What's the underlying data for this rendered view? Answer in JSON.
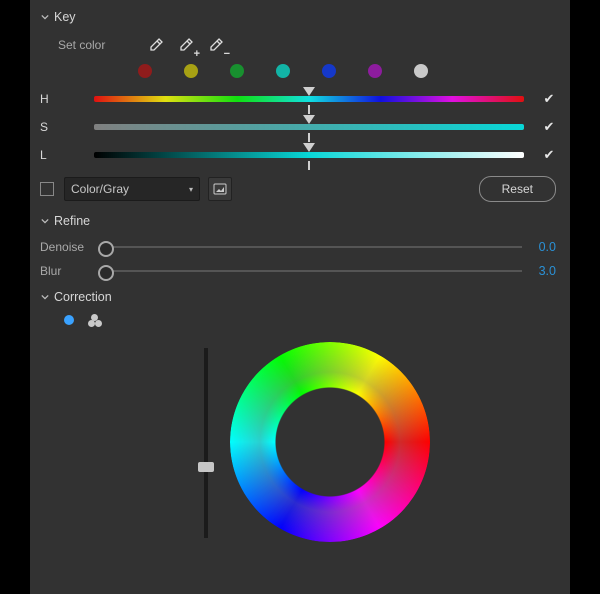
{
  "sections": {
    "key": {
      "title": "Key",
      "set_color_label": "Set color"
    },
    "refine": {
      "title": "Refine"
    },
    "correction": {
      "title": "Correction"
    }
  },
  "swatches": [
    {
      "name": "red",
      "color": "#8f1c1c"
    },
    {
      "name": "yellow",
      "color": "#a7a114"
    },
    {
      "name": "green",
      "color": "#18902f"
    },
    {
      "name": "cyan",
      "color": "#12b4a6"
    },
    {
      "name": "blue",
      "color": "#1538c9"
    },
    {
      "name": "magenta",
      "color": "#8d1c9e"
    },
    {
      "name": "white",
      "color": "#c9c9c9"
    }
  ],
  "hsl": {
    "h": {
      "label": "H",
      "pos_pct": 50,
      "checked": true
    },
    "s": {
      "label": "S",
      "pos_pct": 50,
      "checked": true
    },
    "l": {
      "label": "L",
      "pos_pct": 50,
      "checked": true
    }
  },
  "dropdown": {
    "value": "Color/Gray",
    "checkbox_checked": false
  },
  "reset_label": "Reset",
  "refine": {
    "denoise": {
      "label": "Denoise",
      "value": "0.0",
      "pos_pct": 0
    },
    "blur": {
      "label": "Blur",
      "value": "3.0",
      "pos_pct": 0
    }
  },
  "correction": {
    "active_mode": "single",
    "vertical_pos_pct": 60
  }
}
